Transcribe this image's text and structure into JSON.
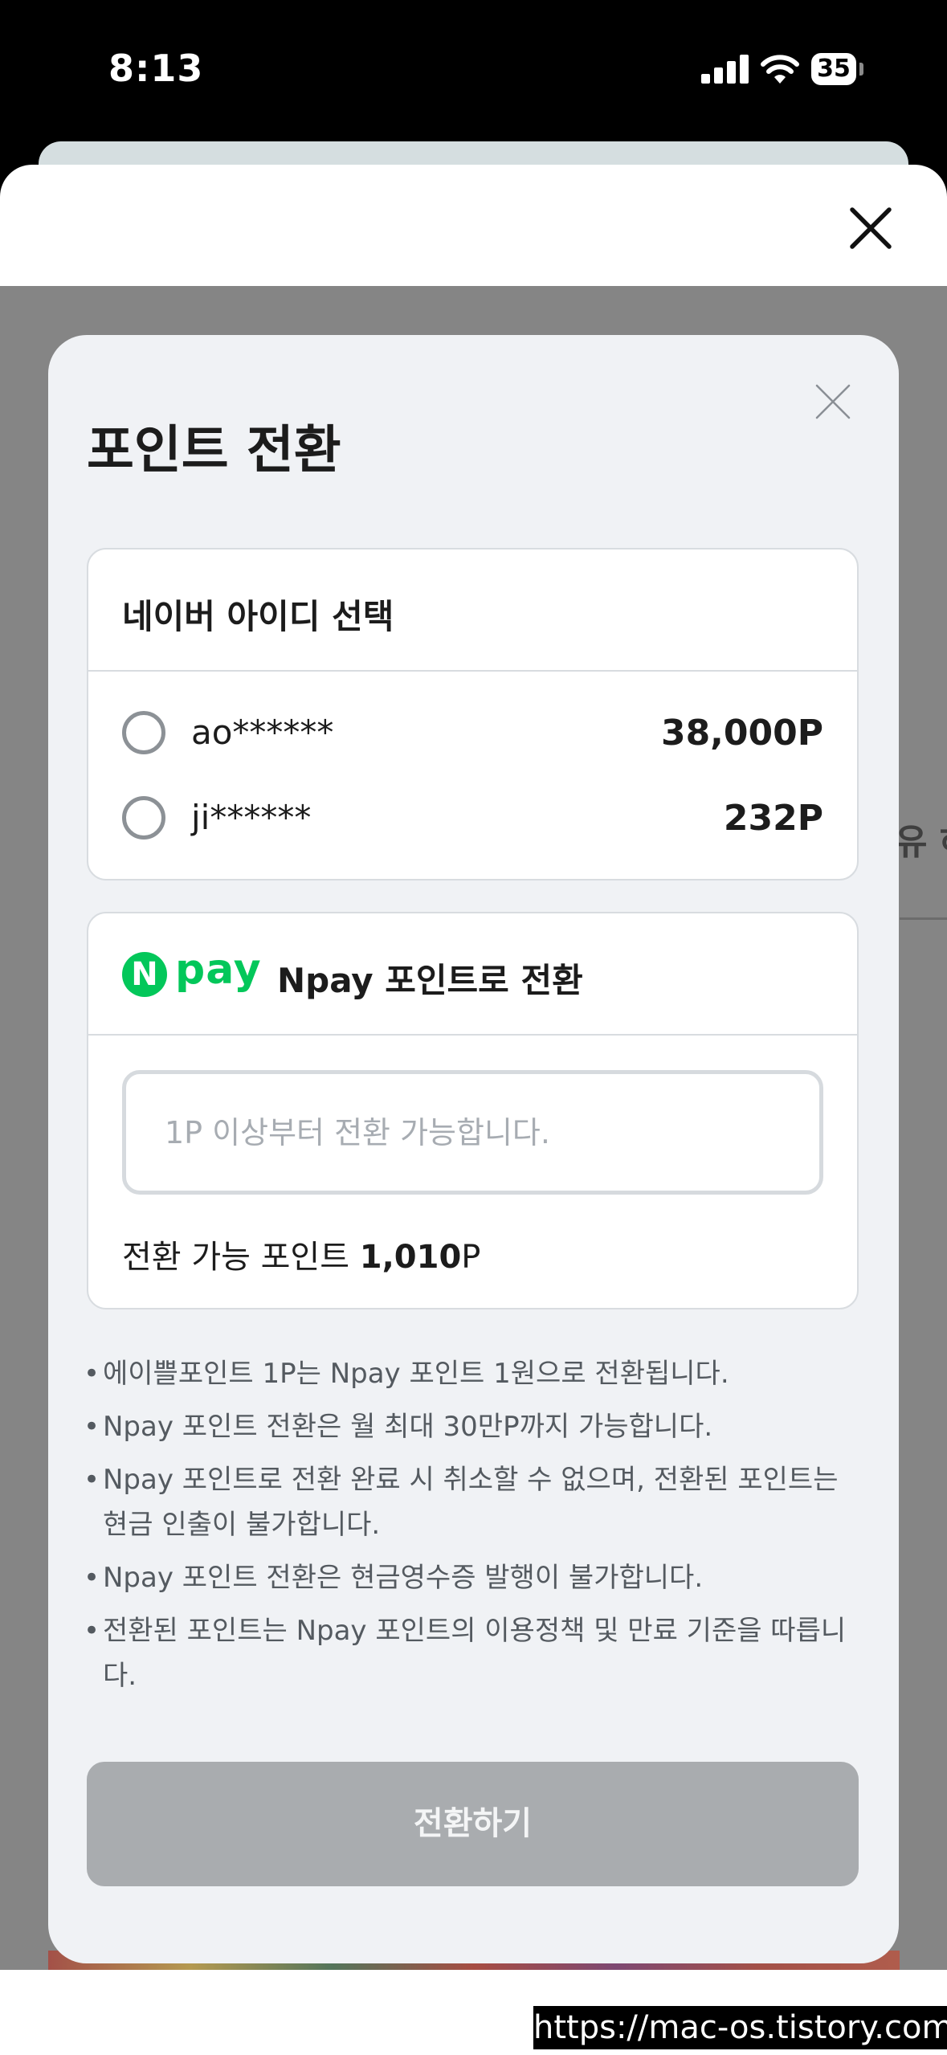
{
  "status_bar": {
    "time": "8:13",
    "battery": "35",
    "signal_icon": "cellular-signal-icon",
    "wifi_icon": "wifi-icon"
  },
  "sheet": {
    "close_icon": "close-icon"
  },
  "background": {
    "partial_text": "유 하"
  },
  "modal": {
    "title": "포인트 전환",
    "close_icon": "close-icon",
    "naver_select": {
      "heading": "네이버 아이디 선택",
      "accounts": [
        {
          "id": "ao******",
          "points": "38,000P",
          "selected": false
        },
        {
          "id": "ji******",
          "points": "232P",
          "selected": false
        }
      ]
    },
    "npay": {
      "logo_mark": "N",
      "logo_text": "pay",
      "heading": "Npay 포인트로 전환",
      "input_value": "",
      "input_placeholder": "1P 이상부터 전환 가능합니다.",
      "available_label": "전환 가능 포인트",
      "available_value": "1,010",
      "available_unit": "P"
    },
    "notes": [
      "에이쁠포인트 1P는 Npay 포인트 1원으로 전환됩니다.",
      "Npay 포인트 전환은 월 최대 30만P까지 가능합니다.",
      "Npay 포인트로 전환 완료 시 취소할 수 없으며, 전환된 포인트는 현금 인출이 불가합니다.",
      "Npay 포인트 전환은 현금영수증 발행이 불가합니다.",
      "전환된 포인트는 Npay 포인트의 이용정책 및 만료 기준을 따릅니다."
    ],
    "submit_label": "전환하기",
    "submit_enabled": false
  },
  "colors": {
    "npay_green": "#03c75a",
    "button_disabled": "#a9acaf",
    "modal_bg": "#f0f2f5",
    "overlay": "#858585"
  },
  "watermark": "https://mac-os.tistory.com"
}
